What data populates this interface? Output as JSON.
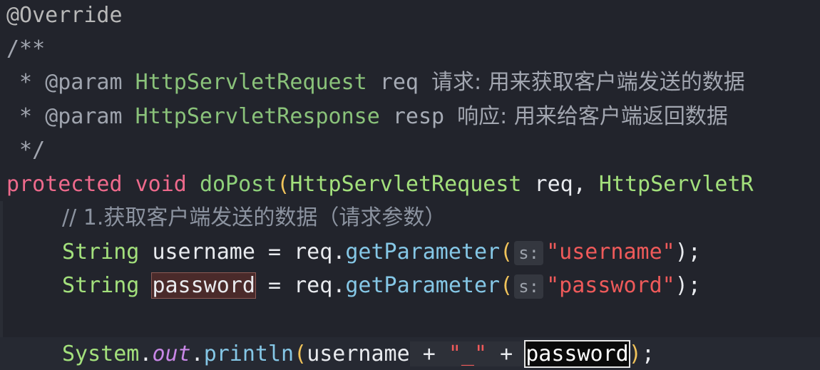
{
  "editor": {
    "lines": {
      "annotation": "@Override",
      "doc_open": "/**",
      "doc_param1": {
        "star": " * ",
        "tag": "@param",
        "type": "HttpServletRequest",
        "name": "req",
        "desc": "请求: 用来获取客户端发送的数据"
      },
      "doc_param2": {
        "star": " * ",
        "tag": "@param",
        "type": "HttpServletResponse",
        "name": "resp",
        "desc": "响应: 用来给客户端返回数据"
      },
      "doc_close": " */",
      "signature": {
        "modifier": "protected",
        "ret": "void",
        "name": "doPost",
        "open": "(",
        "type1": "HttpServletRequest",
        "arg1": "req",
        "comma": ",",
        "type2": "HttpServletR"
      },
      "comment": "// 1.获取客户端发送的数据（请求参数）",
      "decl_username": {
        "type": "String",
        "var": "username",
        "eq": "=",
        "obj": "req",
        "dot": ".",
        "method": "getParameter",
        "open": "(",
        "hint": "s:",
        "arg": "\"username\"",
        "close": ");"
      },
      "decl_password": {
        "type": "String",
        "var": "password",
        "eq": "=",
        "obj": "req",
        "dot": ".",
        "method": "getParameter",
        "open": "(",
        "hint": "s:",
        "arg": "\"password\"",
        "close": ");"
      },
      "println": {
        "cls": "System",
        "dot1": ".",
        "field": "out",
        "dot2": ".",
        "method": "println",
        "open": "(",
        "arg1": "username",
        "plus1": "+",
        "sep": "\"_\"",
        "plus2": "+",
        "arg2": "password",
        "close_paren": ")",
        "semi": ";"
      }
    }
  }
}
